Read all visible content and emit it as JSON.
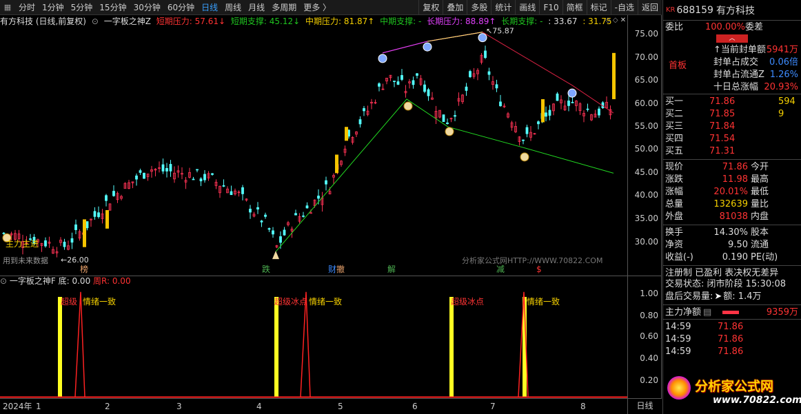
{
  "toolbar": {
    "items": [
      "分时",
      "1分钟",
      "5分钟",
      "15分钟",
      "30分钟",
      "60分钟",
      "日线",
      "周线",
      "月线",
      "多周期",
      "更多 〉"
    ],
    "active_index": 6,
    "right_items": [
      "复权",
      "叠加",
      "多股",
      "统计",
      "画线",
      "F10",
      "简框",
      "标记",
      "-自选",
      "返回"
    ]
  },
  "chart_header": {
    "stock": "有方科技 (日线,前复权)",
    "indicator": "一字板之神Z",
    "short_pressure": "短期压力: 57.61",
    "short_support": "短期支撑: 45.12",
    "mid_pressure": "中期压力: 81.87",
    "mid_support": "中期支撑: -",
    "long_pressure": "长期压力: 88.89",
    "long_support": "长期支撑: -",
    "other1": ": 33.67",
    "other2": ": 31.75"
  },
  "main_axis": [
    "75.00",
    "70.00",
    "65.00",
    "60.00",
    "55.00",
    "50.00",
    "45.00",
    "40.00",
    "35.00",
    "30.00"
  ],
  "annotations": {
    "high_label": "75.87",
    "low_label": "←26.00",
    "main_force": "主力主进",
    "future_note": "用到未来数据",
    "watermark": "分析家公式网HTTP://WWW.70822.COM",
    "events": [
      "榜",
      "跌",
      "财",
      "撤",
      "解",
      "减",
      "$"
    ]
  },
  "sub_header": {
    "name": "一字板之神F",
    "bottom": "底: 0.00",
    "zhou_r": "周R: 0.00"
  },
  "sub_labels": [
    "超级",
    "情绪一致",
    "超级冰点",
    "情绪一致",
    "超级冰点",
    "情绪一致"
  ],
  "sub_axis": [
    "1.00",
    "0.80",
    "0.60",
    "0.40",
    "0.20"
  ],
  "x_axis": {
    "year": "2024年",
    "months": [
      "1",
      "2",
      "3",
      "4",
      "5",
      "6",
      "7",
      "8"
    ],
    "period": "日线"
  },
  "panel": {
    "badge": "KR",
    "code": "688159",
    "name": "有方科技",
    "weibi_label": "委比",
    "weibi_value": "100.00%",
    "weicha_label": "委差",
    "board_label": "首板",
    "seal_rows": [
      {
        "label": "↑当前封单额",
        "value": "5941万"
      },
      {
        "label": "封单占成交",
        "value": "0.06倍"
      },
      {
        "label": "封单占流通Z",
        "value": "1.26%"
      },
      {
        "label": "十日总涨幅",
        "value": "20.93%"
      }
    ],
    "bids": [
      {
        "label": "买一",
        "price": "71.86",
        "vol": "594"
      },
      {
        "label": "买二",
        "price": "71.85",
        "vol": "9"
      },
      {
        "label": "买三",
        "price": "71.84",
        "vol": ""
      },
      {
        "label": "买四",
        "price": "71.54",
        "vol": ""
      },
      {
        "label": "买五",
        "price": "71.31",
        "vol": ""
      }
    ],
    "quote": [
      {
        "l1": "现价",
        "v1": "71.86",
        "l2": "今开"
      },
      {
        "l1": "涨跌",
        "v1": "11.98",
        "l2": "最高"
      },
      {
        "l1": "涨幅",
        "v1": "20.01%",
        "l2": "最低"
      },
      {
        "l1": "总量",
        "v1": "132639",
        "l2": "量比"
      },
      {
        "l1": "外盘",
        "v1": "81038",
        "l2": "内盘"
      }
    ],
    "stats": [
      {
        "l1": "换手",
        "v1": "14.30%",
        "l2": "股本"
      },
      {
        "l1": "净资",
        "v1": "9.50",
        "l2": "流通"
      },
      {
        "l1": "收益(-)",
        "v1": "0.190",
        "l2": "PE(动)"
      }
    ],
    "info1": "注册制 已盈利 表决权无差异",
    "info2": "交易状态: 闭市阶段 15:30:08",
    "info3": "盘后交易量: ",
    "info3b": "额: 1.4万",
    "net_label": "主力净额",
    "net_value": "9359万",
    "ticks": [
      {
        "time": "14:59",
        "price": "71.86"
      },
      {
        "time": "14:59",
        "price": "71.86"
      },
      {
        "time": "14:59",
        "price": "71.86"
      }
    ],
    "logo_text": "分析家公式网",
    "logo_url": "www.70822.com"
  }
}
